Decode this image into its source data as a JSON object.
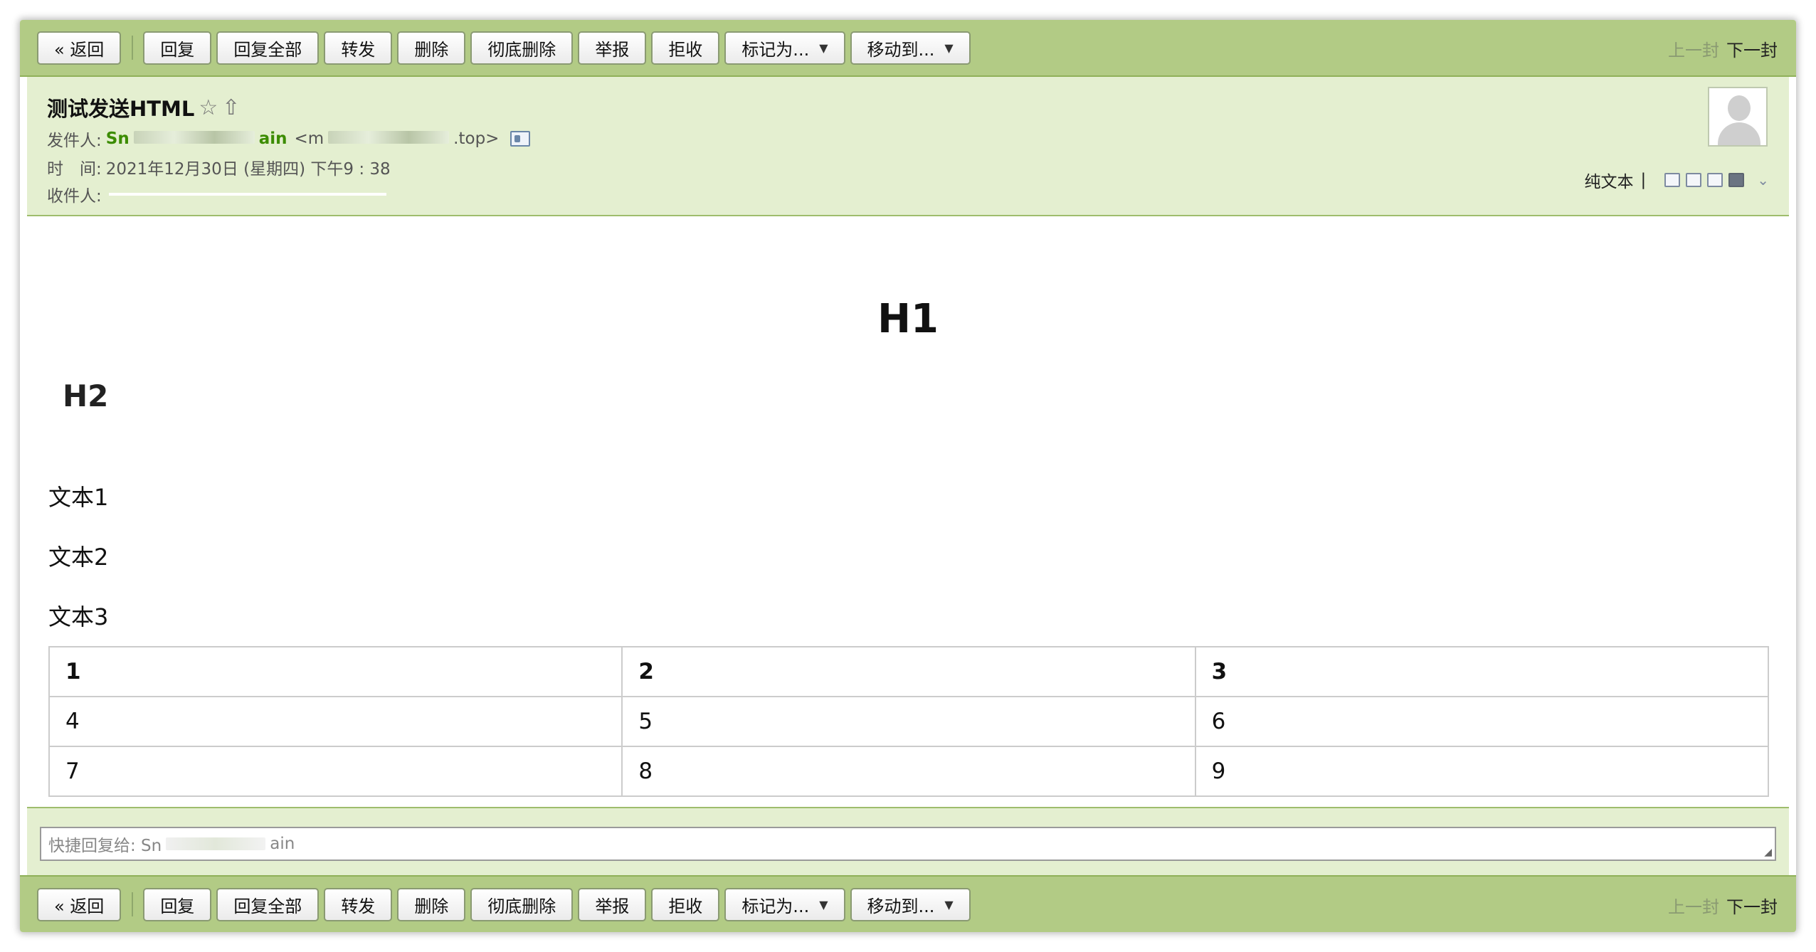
{
  "toolbar": {
    "back": "« 返回",
    "reply": "回复",
    "reply_all": "回复全部",
    "forward": "转发",
    "delete": "删除",
    "delete_permanent": "彻底删除",
    "report": "举报",
    "reject": "拒收",
    "mark_as": "标记为...",
    "move_to": "移动到...",
    "prev": "上一封",
    "next": "下一封"
  },
  "header": {
    "subject": "测试发送HTML",
    "star_icon": "☆",
    "flag_icon": "⇧",
    "from_label": "发件人:",
    "from_name_start": "Sn",
    "from_name_end": "ain",
    "from_email_start": "<m",
    "from_email_end": ".top>",
    "time_label": "时　间:",
    "time_value": "2021年12月30日 (星期四) 下午9 : 38",
    "to_label": "收件人:",
    "plain_text": "纯文本",
    "pipe": "|"
  },
  "body": {
    "h1": "H1",
    "h2": "H2",
    "paragraphs": [
      "文本1",
      "文本2",
      "文本3"
    ],
    "table": {
      "header": [
        "1",
        "2",
        "3"
      ],
      "rows": [
        [
          "4",
          "5",
          "6"
        ],
        [
          "7",
          "8",
          "9"
        ]
      ]
    }
  },
  "quick_reply": {
    "label_start": "快捷回复给: Sn",
    "label_end": "ain"
  },
  "colors": {
    "toolbar_bg": "#b2cb85",
    "header_bg": "#e4efd0",
    "sender_green": "#3c8c00"
  }
}
